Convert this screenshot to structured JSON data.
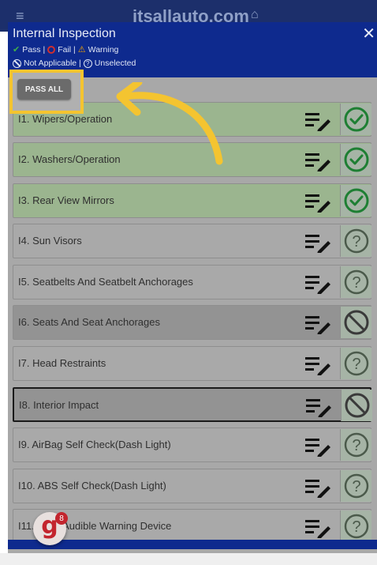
{
  "topbar": {
    "brand": "itsallauto.com",
    "menu_icon": "menu-icon",
    "home_icon": "home-icon"
  },
  "modal": {
    "title": "Internal Inspection",
    "close": "✕",
    "legend": {
      "pass": "Pass |",
      "fail": "Fail |",
      "warning": "Warning",
      "not_applicable": "Not Applicable |",
      "unselected": "Unselected"
    },
    "pass_all": "PASS ALL"
  },
  "items": [
    {
      "label": "I1. Wipers/Operation",
      "status": "pass"
    },
    {
      "label": "I2. Washers/Operation",
      "status": "pass"
    },
    {
      "label": "I3. Rear View Mirrors",
      "status": "pass"
    },
    {
      "label": "I4. Sun Visors",
      "status": "unselected"
    },
    {
      "label": "I5. Seatbelts And Seatbelt Anchorages",
      "status": "unselected"
    },
    {
      "label": "I6. Seats And Seat Anchorages",
      "status": "not_applicable"
    },
    {
      "label": "I7. Head Restraints",
      "status": "unselected"
    },
    {
      "label": "I8. Interior Impact",
      "status": "not_applicable",
      "focused": true
    },
    {
      "label": "I9. AirBag Self Check(Dash Light)",
      "status": "unselected"
    },
    {
      "label": "I10. ABS Self Check(Dash Light)",
      "status": "unselected"
    },
    {
      "label": "I11. Horn/Audible Warning Device",
      "status": "unselected"
    }
  ],
  "fab": {
    "letter": "g",
    "badge": "8"
  },
  "colors": {
    "header": "#0e2a8e",
    "pass": "#2e8b3e",
    "highlight": "#f4c430"
  }
}
